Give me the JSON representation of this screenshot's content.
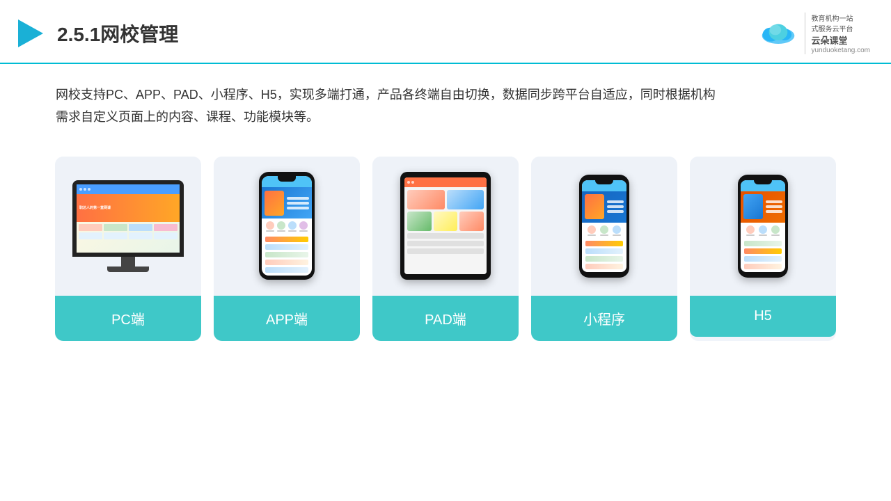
{
  "header": {
    "title": "2.5.1网校管理",
    "logo_name": "云朵课堂",
    "logo_url": "yunduoketang.com",
    "logo_slogan": "教育机构一站\n式服务云平台"
  },
  "description": {
    "text": "网校支持PC、APP、PAD、小程序、H5，实现多端打通，产品各终端自由切换，数据同步跨平台自适应，同时根据机构需求自定义页面上的内容、课程、功能模块等。"
  },
  "cards": [
    {
      "label": "PC端"
    },
    {
      "label": "APP端"
    },
    {
      "label": "PAD端"
    },
    {
      "label": "小程序"
    },
    {
      "label": "H5"
    }
  ],
  "colors": {
    "accent": "#3fc8c8",
    "header_border": "#00bcd4",
    "card_bg": "#f0f4fa"
  }
}
